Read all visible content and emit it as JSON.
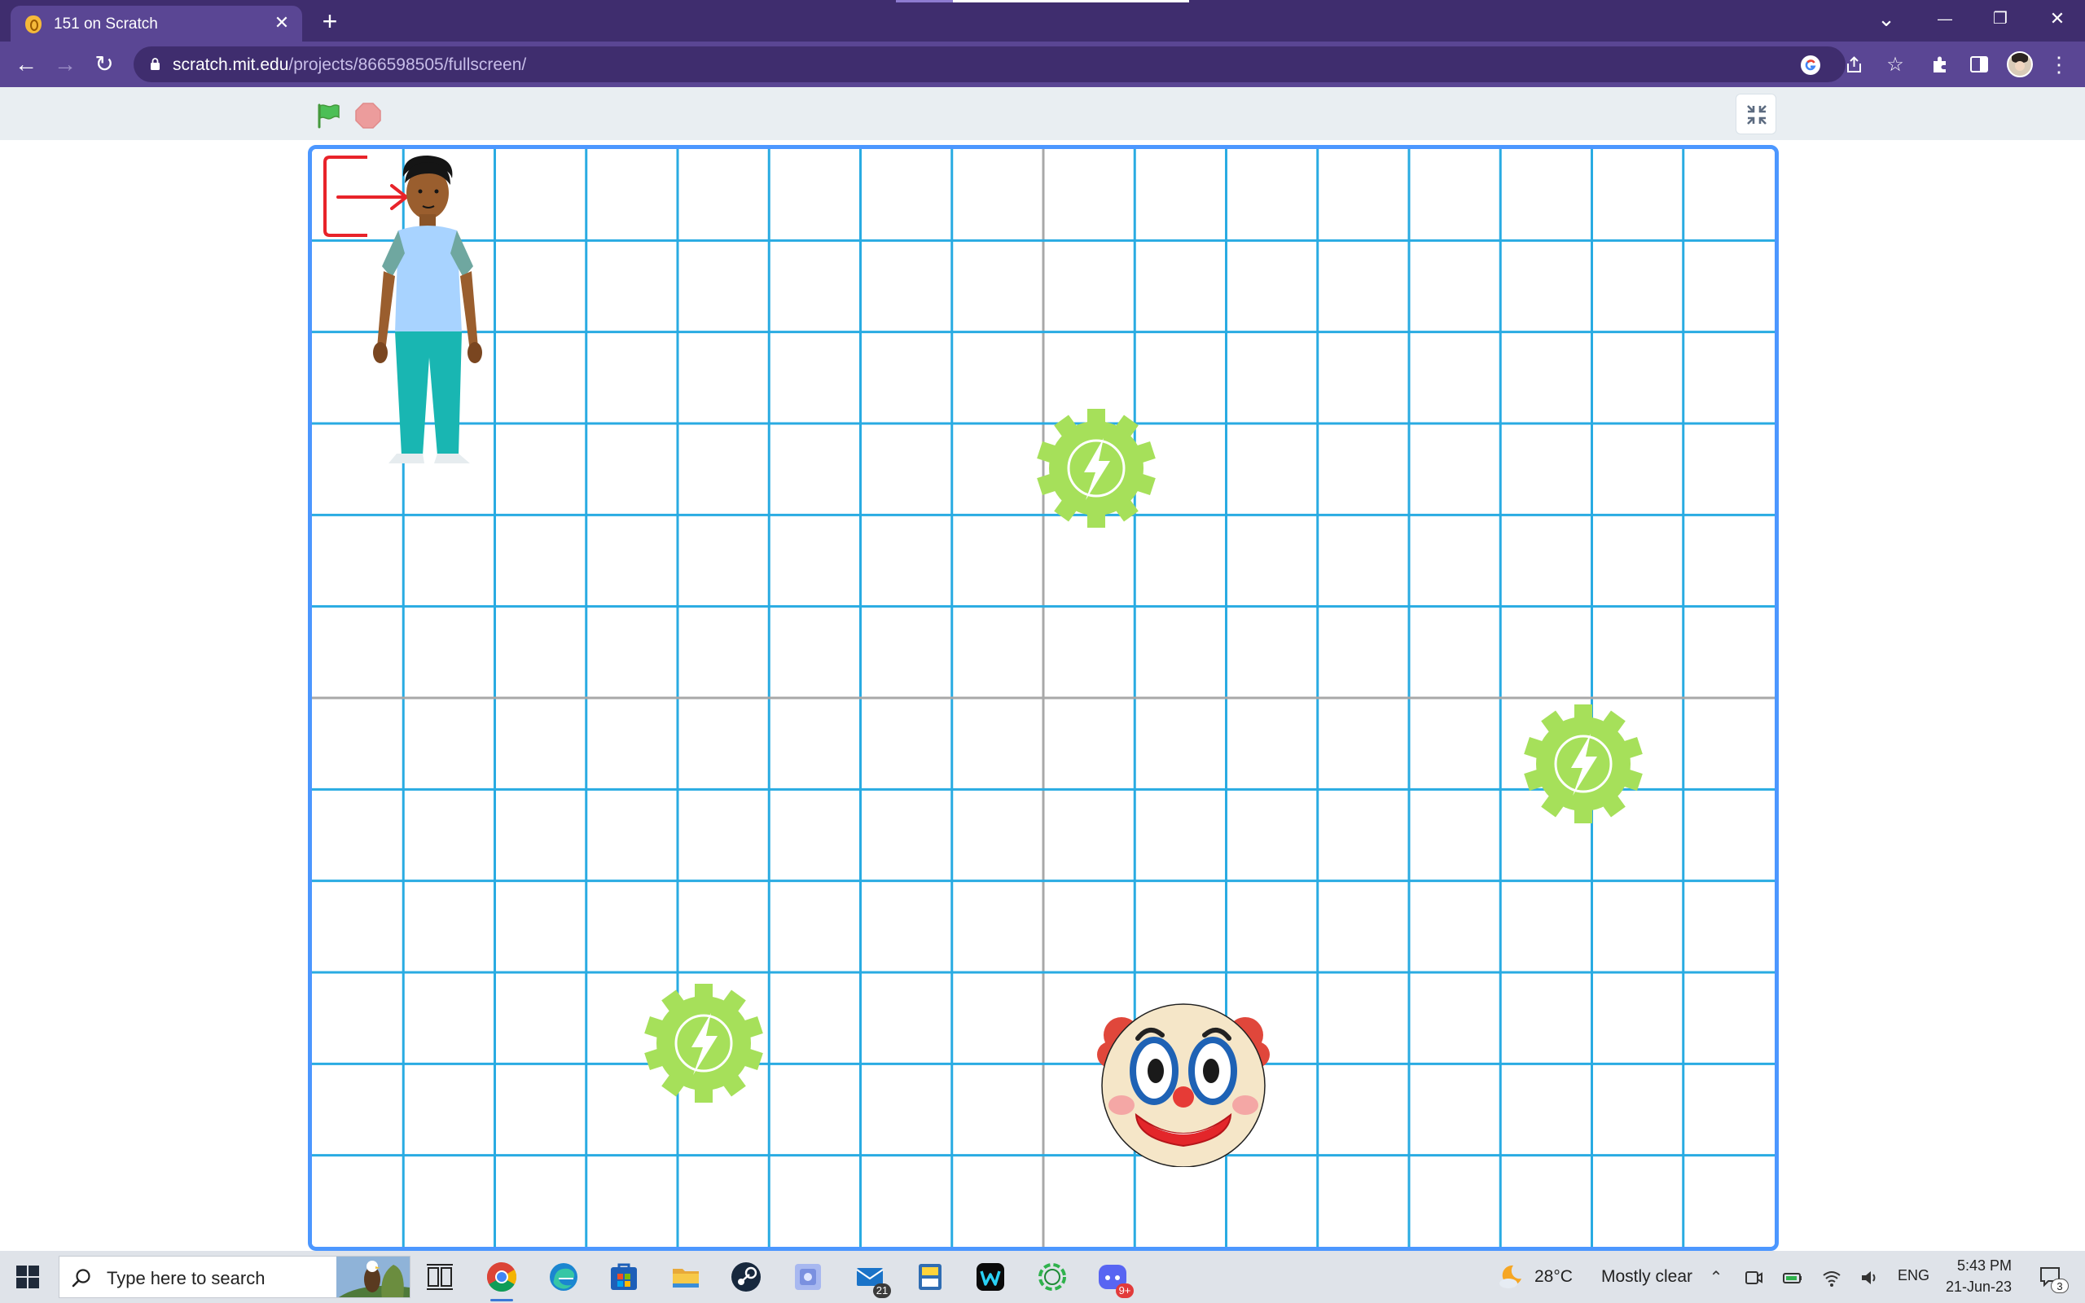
{
  "browser": {
    "tab_title": "151 on Scratch",
    "tab_close_glyph": "✕",
    "new_tab_glyph": "+",
    "url_host": "scratch.mit.edu",
    "url_path": "/projects/866598505/fullscreen/",
    "window_controls": {
      "dropdown": "⌄",
      "minimize": "—",
      "restore": "❐",
      "close": "✕"
    },
    "nav": {
      "back": "←",
      "forward": "→",
      "reload": "↻"
    },
    "omnibox_icons": [
      "google-icon",
      "share-icon",
      "bookmark-star-icon"
    ],
    "toolbar_icons": [
      "extensions-icon",
      "side-panel-icon",
      "profile-avatar"
    ],
    "theme_colors": {
      "tab_strip": "#3f2d6e",
      "toolbar": "#5a4694"
    }
  },
  "player": {
    "controls": [
      "green-flag-icon",
      "stop-sign-icon",
      "exit-fullscreen-icon"
    ],
    "stage": {
      "grid_columns": 16,
      "grid_rows": 12,
      "grid_color": "#29abe2",
      "axis_color": "#a8a8a8",
      "border_color": "#4c97ff"
    },
    "sprites": [
      {
        "name": "boy-character",
        "col": 1,
        "row": 0
      },
      {
        "name": "entry-arrow-marker",
        "col": 0,
        "row": 0
      },
      {
        "name": "energy-gear",
        "col": 8,
        "row": 3
      },
      {
        "name": "energy-gear",
        "col": 13,
        "row": 6
      },
      {
        "name": "energy-gear",
        "col": 4,
        "row": 9
      },
      {
        "name": "clown-face",
        "col": 9,
        "row": 10
      }
    ]
  },
  "taskbar": {
    "search_placeholder": "Type here to search",
    "apps": [
      {
        "name": "task-view-icon"
      },
      {
        "name": "chrome-icon",
        "active": true
      },
      {
        "name": "edge-icon"
      },
      {
        "name": "microsoft-store-icon"
      },
      {
        "name": "file-explorer-icon"
      },
      {
        "name": "steam-icon"
      },
      {
        "name": "photos-app-icon"
      },
      {
        "name": "mail-icon",
        "badge": "21"
      },
      {
        "name": "python-idle-icon"
      },
      {
        "name": "webex-icon"
      },
      {
        "name": "sync-app-icon"
      },
      {
        "name": "discord-icon",
        "badge": "9+"
      }
    ],
    "weather": {
      "temp": "28°C",
      "condition": "Mostly clear"
    },
    "language": "ENG",
    "time": "5:43 PM",
    "date": "21-Jun-23",
    "notification_count": "3"
  }
}
